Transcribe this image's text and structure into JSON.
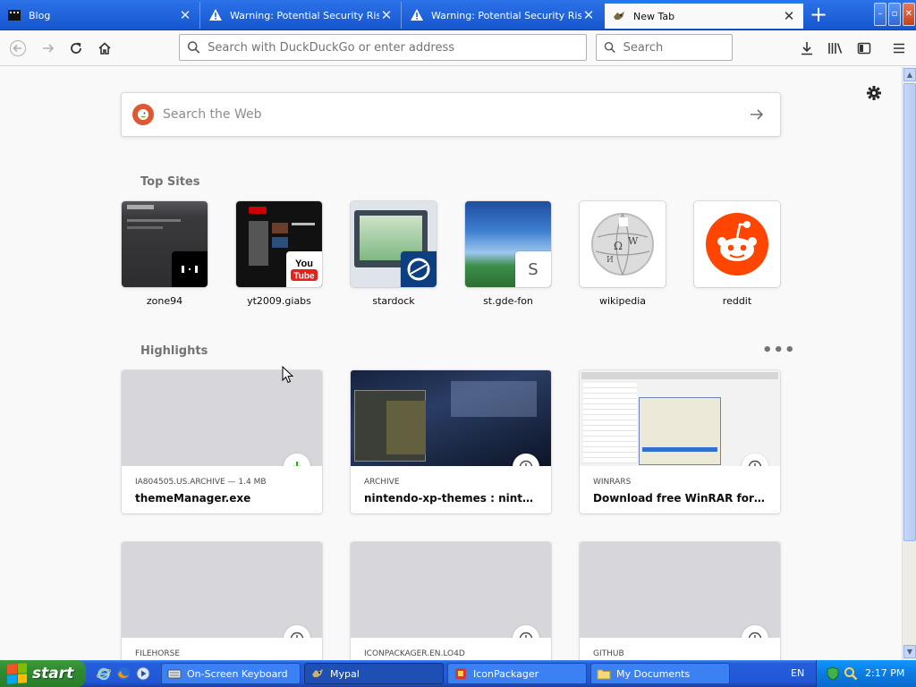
{
  "tabs": [
    {
      "title": "Blog",
      "icon": "blog-favicon"
    },
    {
      "title": "Warning: Potential Security Risk Ahead",
      "icon": "warning-icon"
    },
    {
      "title": "Warning: Potential Security Risk Ahead",
      "icon": "warning-icon"
    },
    {
      "title": "New Tab",
      "icon": "mypal-favicon",
      "active": true
    }
  ],
  "toolbar": {
    "url_placeholder": "Search with DuckDuckGo or enter address",
    "search_placeholder": "Search"
  },
  "newtab": {
    "websearch_placeholder": "Search the Web",
    "top_sites_heading": "Top Sites",
    "highlights_heading": "Highlights",
    "top_sites": [
      {
        "label": "zone94"
      },
      {
        "label": "yt2009.giabs"
      },
      {
        "label": "stardock"
      },
      {
        "label": "st.gde-fon",
        "letter": "S"
      },
      {
        "label": "wikipedia"
      },
      {
        "label": "reddit"
      }
    ],
    "highlights": [
      {
        "source": "IA804505.US.ARCHIVE — 1.4 MB",
        "title": "themeManager.exe",
        "badge": "download-icon"
      },
      {
        "source": "ARCHIVE",
        "title": "nintendo-xp-themes : nintendo-xp-themes",
        "badge": "clock-icon"
      },
      {
        "source": "WINRARS",
        "title": "Download free WinRAR for Windows",
        "badge": "clock-icon"
      },
      {
        "source": "FILEHORSE",
        "title": "",
        "badge": "clock-icon"
      },
      {
        "source": "ICONPACKAGER.EN.LO4D",
        "title": "",
        "badge": "clock-icon"
      },
      {
        "source": "GITHUB",
        "title": "",
        "badge": "clock-icon"
      }
    ]
  },
  "taskbar": {
    "start_label": "start",
    "tasks": [
      {
        "label": "On-Screen Keyboard"
      },
      {
        "label": "Mypal",
        "active": true
      },
      {
        "label": "IconPackager"
      },
      {
        "label": "My Documents"
      }
    ],
    "language": "EN",
    "clock": "2:17 PM"
  },
  "colors": {
    "accent": "#0a84ff",
    "titlebar": "#245edb",
    "reddit": "#ff4500",
    "duckduckgo": "#de5833",
    "download_green": "#12bc00"
  }
}
